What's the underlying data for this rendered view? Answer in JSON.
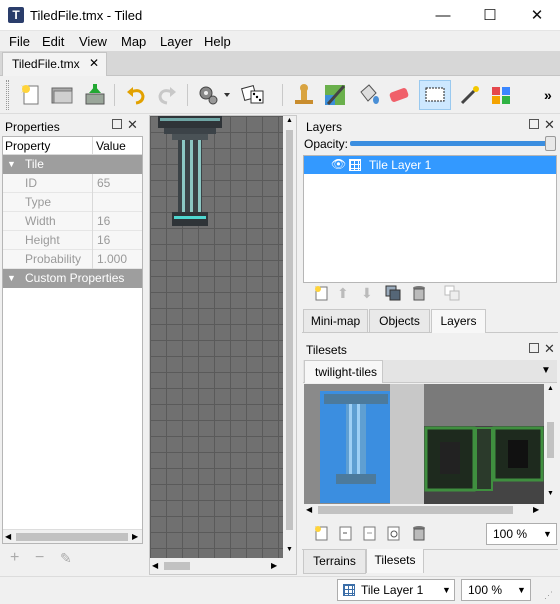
{
  "window": {
    "title": "TiledFile.tmx - Tiled",
    "minimize": "—",
    "maximize": "☐",
    "close": "✕"
  },
  "menu": [
    "File",
    "Edit",
    "View",
    "Map",
    "Layer",
    "Help"
  ],
  "document_tab": {
    "label": "TiledFile.tmx",
    "close": "✕"
  },
  "toolbar": {
    "icons": [
      "new-file-icon",
      "open-folder-icon",
      "save-icon",
      "undo-icon",
      "redo-icon",
      "command-gear-icon",
      "random-dice-icon",
      "stamp-brush-icon",
      "terrain-brush-icon",
      "bucket-fill-icon",
      "eraser-icon",
      "rectangle-select-icon",
      "magic-wand-icon",
      "select-same-tile-icon"
    ],
    "overflow": "»"
  },
  "properties_panel": {
    "title": "Properties",
    "columns": [
      "Property",
      "Value"
    ],
    "group_tile": "Tile",
    "rows": [
      {
        "name": "ID",
        "value": "65"
      },
      {
        "name": "Type",
        "value": ""
      },
      {
        "name": "Width",
        "value": "16"
      },
      {
        "name": "Height",
        "value": "16"
      },
      {
        "name": "Probability",
        "value": "1.000"
      }
    ],
    "group_custom": "Custom Properties"
  },
  "layers_panel": {
    "title": "Layers",
    "opacity_label": "Opacity:",
    "opacity": 1.0,
    "layers": [
      {
        "name": "Tile Layer 1",
        "visible": true,
        "selected": true
      }
    ],
    "tabs": [
      "Mini-map",
      "Objects",
      "Layers"
    ],
    "active_tab": "Layers"
  },
  "tilesets_panel": {
    "title": "Tilesets",
    "tileset_tab": "twilight-tiles",
    "zoom": "100 %",
    "tabs": [
      "Terrains",
      "Tilesets"
    ],
    "active_tab": "Tilesets"
  },
  "status": {
    "current_layer": "Tile Layer 1",
    "zoom": "100 %"
  },
  "colors": {
    "selection": "#3399ff",
    "header_group": "#9e9e9e",
    "canvas": "#6f6f6f"
  }
}
